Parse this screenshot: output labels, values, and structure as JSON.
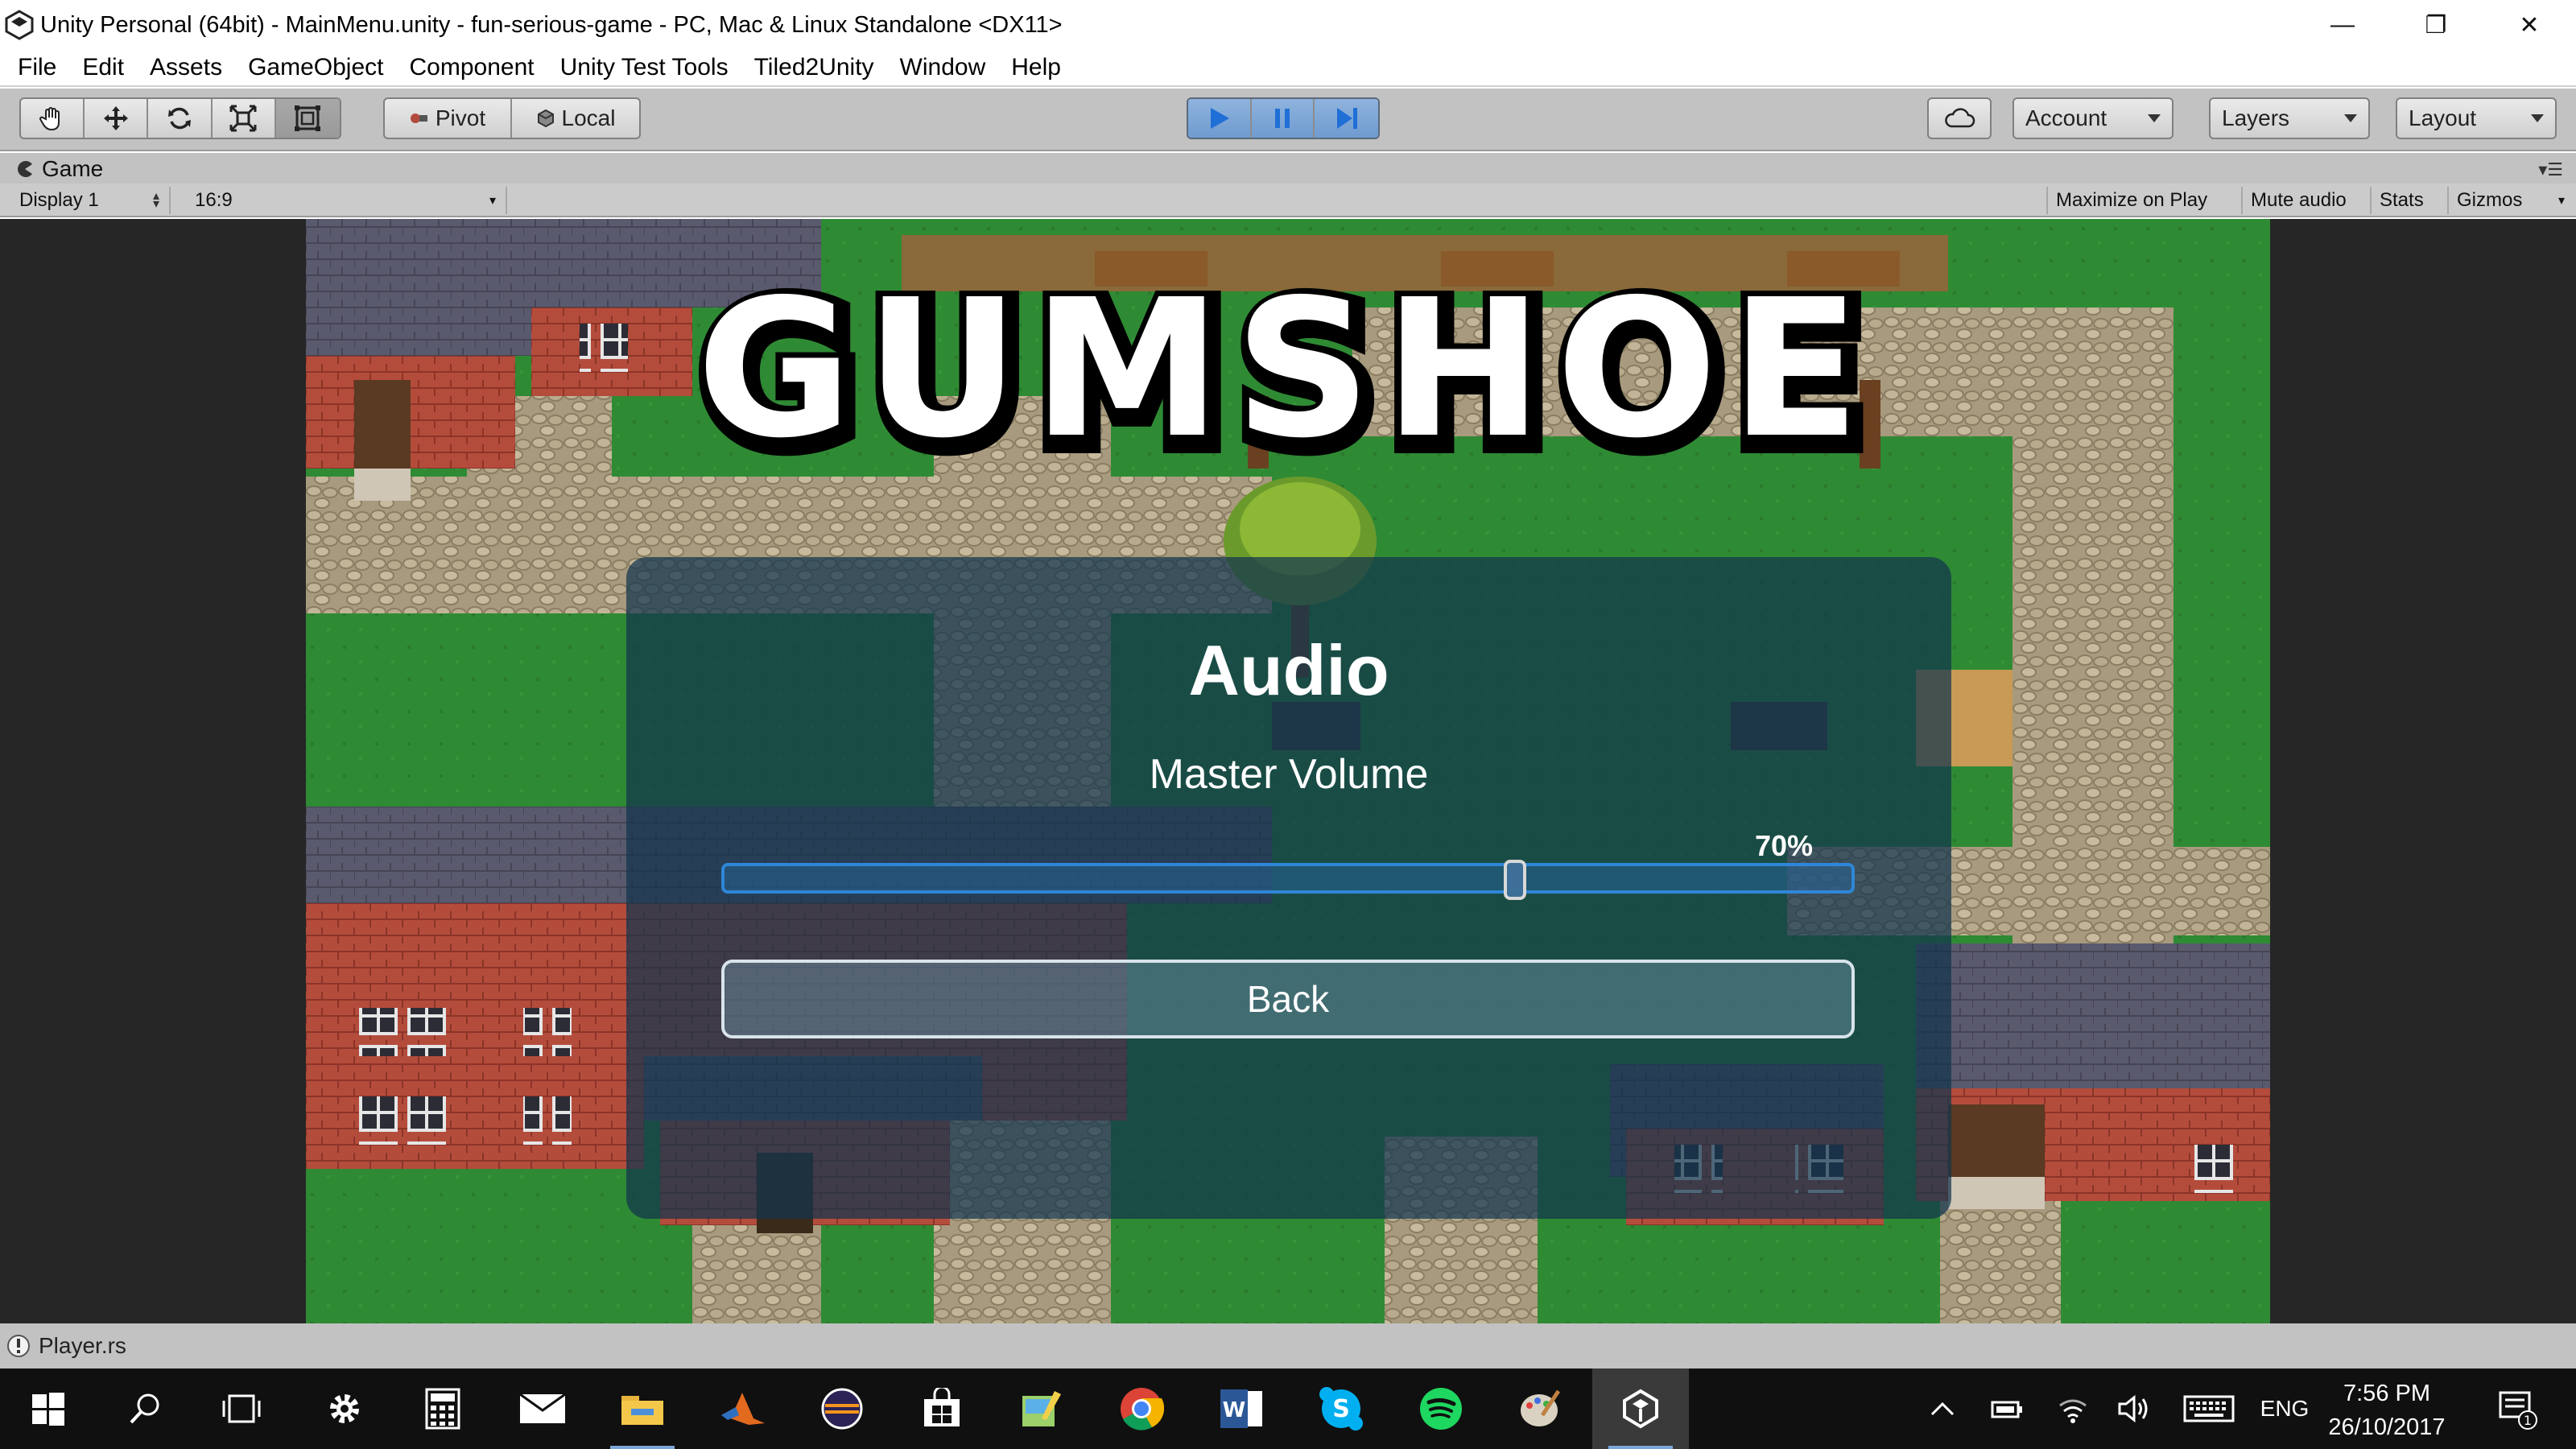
{
  "window": {
    "title": "Unity Personal (64bit) - MainMenu.unity - fun-serious-game - PC, Mac & Linux Standalone <DX11>",
    "minimize_glyph": "—",
    "restore_glyph": "❐",
    "close_glyph": "✕"
  },
  "menu": {
    "items": [
      "File",
      "Edit",
      "Assets",
      "GameObject",
      "Component",
      "Unity Test Tools",
      "Tiled2Unity",
      "Window",
      "Help"
    ]
  },
  "toolbar": {
    "transform_tools": [
      "hand-icon",
      "move-icon",
      "rotate-icon",
      "scale-icon",
      "rect-tool-icon"
    ],
    "pivot_label": "Pivot",
    "local_label": "Local",
    "play_controls": [
      "play-icon",
      "pause-icon",
      "step-icon"
    ],
    "cloud_icon": "cloud-icon",
    "account_label": "Account",
    "layers_label": "Layers",
    "layout_label": "Layout",
    "accent_color": "#1f6fd6"
  },
  "game_panel": {
    "tab_label": "Game",
    "display_label": "Display 1",
    "aspect_label": "16:9",
    "maximize_label": "Maximize on Play",
    "mute_label": "Mute audio",
    "stats_label": "Stats",
    "gizmos_label": "Gizmos"
  },
  "game": {
    "logo_text": "GUMSHOE",
    "audio_title": "Audio",
    "volume_label": "Master Volume",
    "volume_value": "70%",
    "volume_level": 0.7,
    "back_label": "Back",
    "slider_color": "#2f86d8"
  },
  "status": {
    "text": "Player.rs"
  },
  "taskbar": {
    "apps": [
      "start-icon",
      "search-icon",
      "task-view-icon",
      "settings-icon",
      "calculator-icon",
      "mail-icon",
      "file-explorer-icon",
      "matlab-icon",
      "eclipse-icon",
      "store-icon",
      "paint-icon",
      "chrome-icon",
      "word-icon",
      "skype-icon",
      "spotify-icon",
      "paint-palette-icon",
      "unity-icon"
    ],
    "language": "ENG",
    "time": "7:56 PM",
    "date": "26/10/2017",
    "notification_count": "1"
  }
}
